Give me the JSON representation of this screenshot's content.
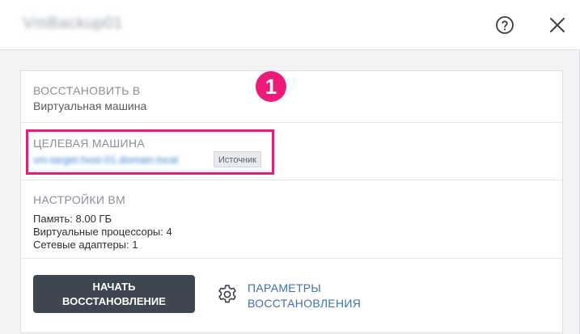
{
  "header": {
    "title": "VmBackup01",
    "help_icon": "question-circle-icon",
    "close_icon": "close-icon"
  },
  "restore_to": {
    "label": "ВОССТАНОВИТЬ В",
    "value": "Виртуальная машина"
  },
  "target_machine": {
    "label": "ЦЕЛЕВАЯ МАШИНА",
    "name": "vm-target-host-01.domain.local",
    "badge": "Источник",
    "callout_number": "1",
    "highlight_color": "#ec1b7a"
  },
  "vm_settings": {
    "label": "НАСТРОЙКИ ВМ",
    "memory": "Память: 8.00 ГБ",
    "cpus": "Виртуальные процессоры: 4",
    "adapters": "Сетевые адаптеры: 1"
  },
  "actions": {
    "start_line1": "НАЧАТЬ",
    "start_line2": "ВОССТАНОВЛЕНИЕ",
    "options_line1": "ПАРАМЕТРЫ",
    "options_line2": "ВОССТАНОВЛЕНИЯ",
    "options_icon": "gear-icon"
  }
}
